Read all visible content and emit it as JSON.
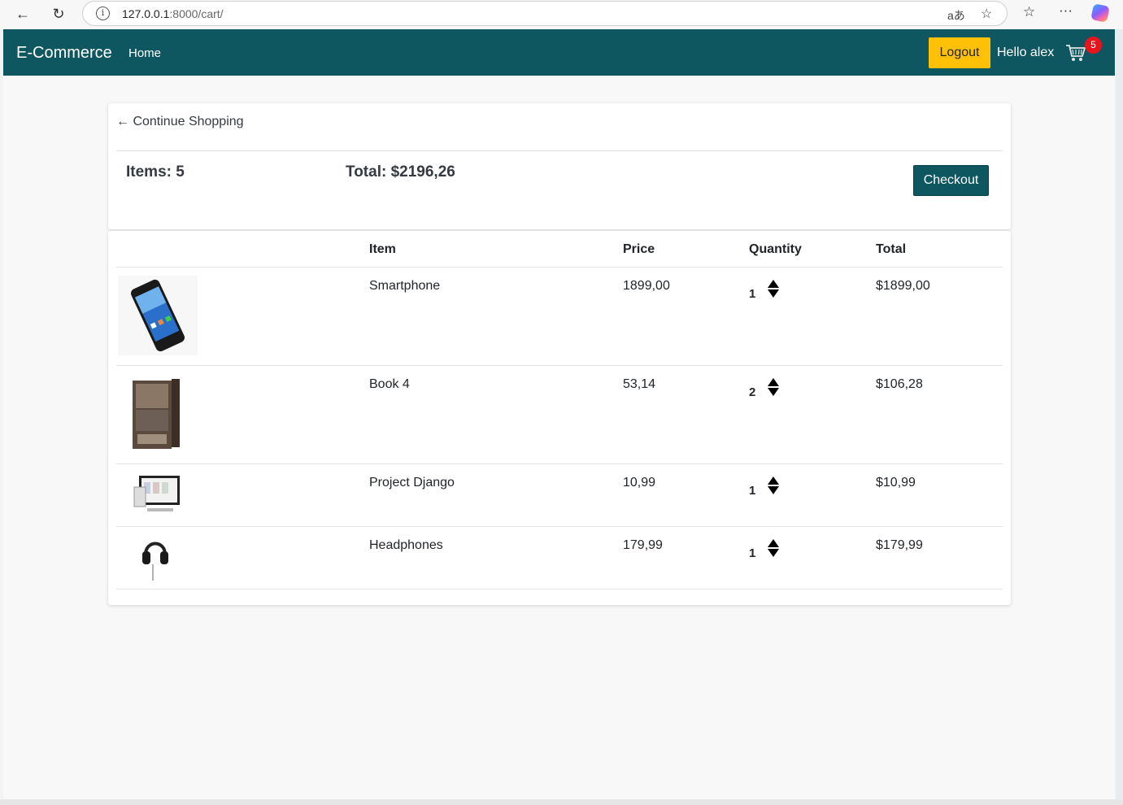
{
  "browser": {
    "url_host": "127.0.0.1",
    "url_path": ":8000/cart/"
  },
  "navbar": {
    "brand": "E-Commerce",
    "home": "Home",
    "logout": "Logout",
    "greeting": "Hello alex",
    "cart_count": "5"
  },
  "summary": {
    "continue": "← Continue Shopping",
    "items": "Items: 5",
    "total": "Total: $2196,26",
    "checkout": "Checkout"
  },
  "table": {
    "headers": {
      "item": "Item",
      "price": "Price",
      "quantity": "Quantity",
      "total": "Total"
    },
    "rows": [
      {
        "name": "Smartphone",
        "price": "1899,00",
        "qty": "1",
        "total": "$1899,00",
        "image": "smartphone-image"
      },
      {
        "name": "Book 4",
        "price": "53,14",
        "qty": "2",
        "total": "$106,28",
        "image": "book-image"
      },
      {
        "name": "Project Django",
        "price": "10,99",
        "qty": "1",
        "total": "$10,99",
        "image": "devices-image"
      },
      {
        "name": "Headphones",
        "price": "179,99",
        "qty": "1",
        "total": "$179,99",
        "image": "headphones-image"
      }
    ]
  },
  "colors": {
    "navbar": "#0e5761",
    "logout": "#ffc107",
    "checkout": "#0e5761",
    "badge": "#e8141c"
  }
}
